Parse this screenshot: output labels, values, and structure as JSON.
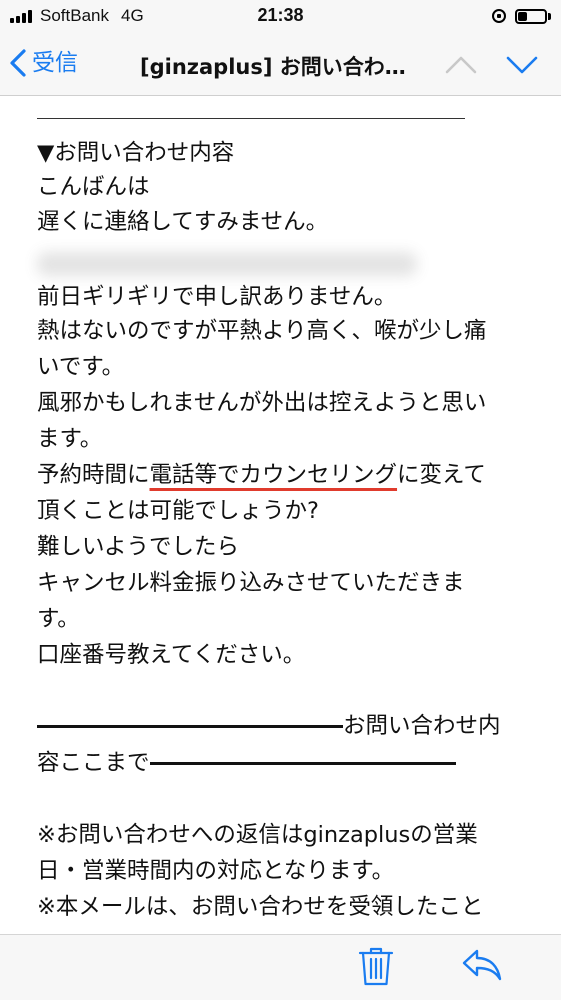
{
  "status_bar": {
    "carrier": "SoftBank",
    "network": "4G",
    "time": "21:38",
    "battery_level": 0.35,
    "icons": [
      "signal-icon",
      "rotation-lock-icon",
      "battery-icon"
    ]
  },
  "nav": {
    "back_label": "受信",
    "title": "[ginzaplus] お問い合わ…",
    "icons": [
      "chevron-left-icon",
      "chevron-up-icon",
      "chevron-down-icon"
    ],
    "accent_color": "#1a7cf0"
  },
  "body": {
    "lines": [
      "▼お問い合わせ内容",
      "こんばんは",
      "遅くに連絡してすみません。",
      "前日ギリギリで申し訳ありません。",
      "熱はないのですが平熱より高く、喉が少し痛",
      "いです。",
      "風邪かもしれませんが外出は控えようと思い",
      "ます。"
    ],
    "reservation_line": {
      "before": "予約時間に",
      "highlight": "電話等でカウンセリング",
      "after": "に変えて"
    },
    "lines_after": [
      "頂くことは可能でしょうか?",
      "難しいようでしたら",
      "キャンセル料金振り込みさせていただきま",
      "す。",
      "口座番号教えてください。"
    ],
    "divider_end_1": "お問い合わせ内",
    "divider_end_2_prefix": "容ここまで",
    "notice_lines": [
      "※お問い合わせへの返信はginzaplusの営業",
      "日・営業時間内の対応となります。",
      "※本メールは、お問い合わせを受領したこと"
    ],
    "highlight_color": "#e03b2d"
  },
  "toolbar": {
    "icons": [
      "trash-icon",
      "reply-icon"
    ]
  }
}
